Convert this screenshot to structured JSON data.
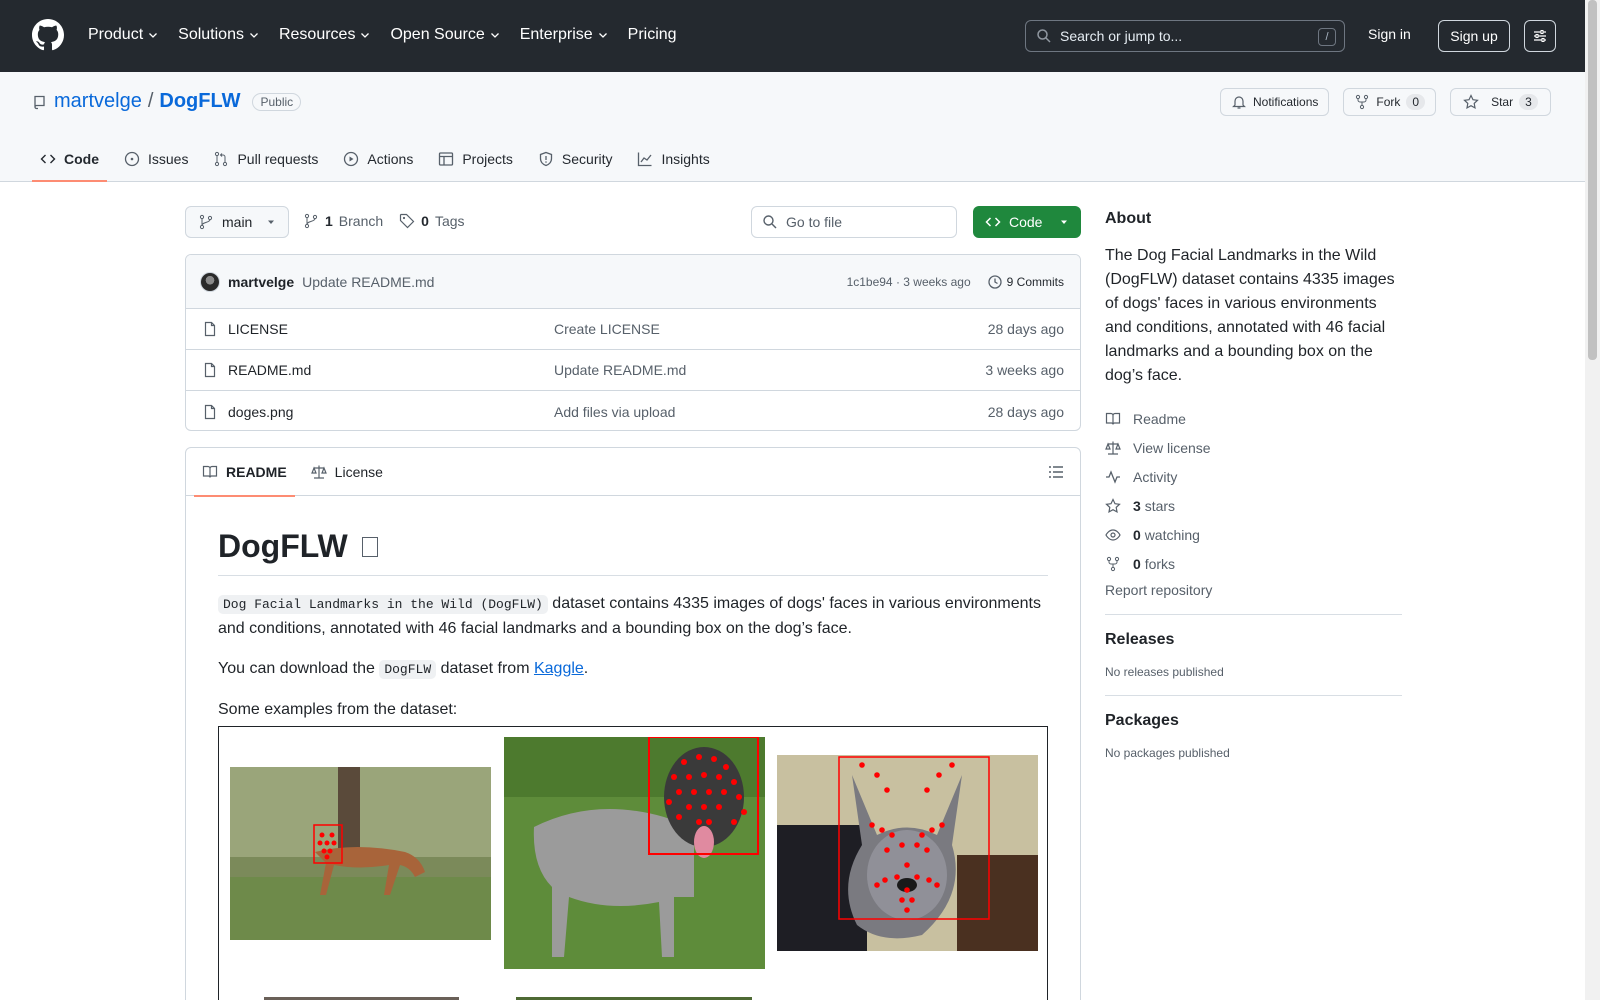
{
  "header": {
    "nav": [
      "Product",
      "Solutions",
      "Resources",
      "Open Source",
      "Enterprise",
      "Pricing"
    ],
    "search_placeholder": "Search or jump to...",
    "search_shortcut": "/",
    "signin": "Sign in",
    "signup": "Sign up"
  },
  "repo": {
    "owner": "martvelge",
    "separator": "/",
    "name": "DogFLW",
    "visibility": "Public",
    "notifications": "Notifications",
    "fork": "Fork",
    "fork_count": "0",
    "star": "Star",
    "star_count": "3"
  },
  "tabs": [
    "Code",
    "Issues",
    "Pull requests",
    "Actions",
    "Projects",
    "Security",
    "Insights"
  ],
  "branch": {
    "name": "main",
    "branch_count": "1",
    "branch_label": "Branch",
    "tag_count": "0",
    "tag_label": "Tags",
    "goto_placeholder": "Go to file",
    "code_button": "Code"
  },
  "commit": {
    "author": "martvelge",
    "message": "Update README.md",
    "hash_time": "1c1be94 · 3 weeks ago",
    "commits": "9 Commits"
  },
  "files": [
    {
      "name": "LICENSE",
      "message": "Create LICENSE",
      "date": "28 days ago"
    },
    {
      "name": "README.md",
      "message": "Update README.md",
      "date": "3 weeks ago"
    },
    {
      "name": "doges.png",
      "message": "Add files via upload",
      "date": "28 days ago"
    }
  ],
  "readme": {
    "tab_readme": "README",
    "tab_license": "License",
    "title": "DogFLW",
    "p1_code": "Dog Facial Landmarks in the Wild (DogFLW)",
    "p1_text": " dataset contains 4335 images of dogs' faces in various environments and conditions, annotated with 46 facial landmarks and a bounding box on the dog’s face.",
    "p2_pre": "You can download the ",
    "p2_code": "DogFLW",
    "p2_mid": " dataset from ",
    "p2_link": "Kaggle",
    "p2_post": ".",
    "p3": "Some examples from the dataset:"
  },
  "sidebar": {
    "about_title": "About",
    "about_text": "The Dog Facial Landmarks in the Wild (DogFLW) dataset contains 4335 images of dogs' faces in various environments and conditions, annotated with 46 facial landmarks and a bounding box on the dog’s face.",
    "readme": "Readme",
    "license": "View license",
    "activity": "Activity",
    "stars_count": "3",
    "stars_label": "stars",
    "watching_count": "0",
    "watching_label": "watching",
    "forks_count": "0",
    "forks_label": "forks",
    "report": "Report repository",
    "releases_title": "Releases",
    "releases_text": "No releases published",
    "packages_title": "Packages",
    "packages_text": "No packages published"
  },
  "colors": {
    "header_bg": "#24292f",
    "link": "#0969da",
    "code_button": "#1f883d",
    "tab_underline": "#fd8c73",
    "landmark": "#ff0000"
  }
}
